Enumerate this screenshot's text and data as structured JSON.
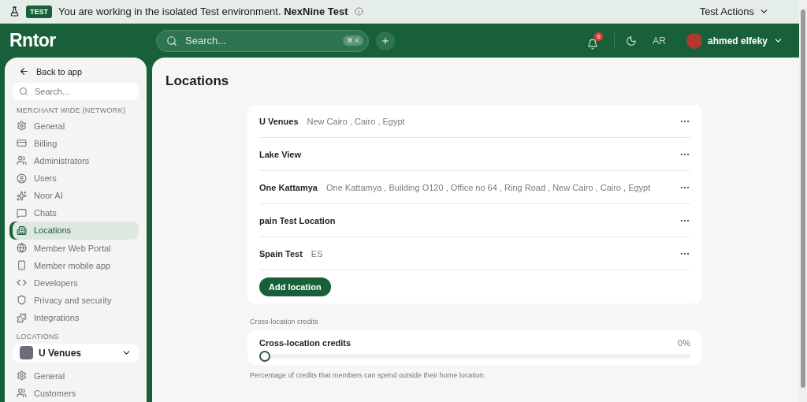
{
  "banner": {
    "badge": "TEST",
    "message": "You are working in the isolated Test environment. **NexNine Test**",
    "actions": "Test Actions"
  },
  "header": {
    "logo": "Rntor",
    "search_placeholder": "Search...",
    "shortcut": "⌘ K",
    "notifications": "6",
    "language": "AR",
    "user": "ahmed elfeky"
  },
  "sidebar": {
    "back": "Back to app",
    "search_placeholder": "Search...",
    "sections": [
      {
        "title": "MERCHANT WIDE (NETWORK)",
        "items": [
          {
            "label": "General",
            "kind": "gear",
            "selected": false
          },
          {
            "label": "Billing",
            "kind": "card",
            "selected": false
          },
          {
            "label": "Administrators",
            "kind": "users",
            "selected": false
          },
          {
            "label": "Users",
            "kind": "user",
            "selected": false
          },
          {
            "label": "Noor AI",
            "kind": "sparkles",
            "selected": false
          },
          {
            "label": "Chats",
            "kind": "chat",
            "selected": false
          },
          {
            "label": "Locations",
            "kind": "building",
            "selected": true
          },
          {
            "label": "Member Web Portal",
            "kind": "globe",
            "selected": false
          },
          {
            "label": "Member mobile app",
            "kind": "phone",
            "selected": false
          },
          {
            "label": "Developers",
            "kind": "code",
            "selected": false
          },
          {
            "label": "Privacy and security",
            "kind": "shield",
            "selected": false
          },
          {
            "label": "Integrations",
            "kind": "puzzle",
            "selected": false
          }
        ]
      },
      {
        "title": "LOCATIONS",
        "location": "U Venues",
        "items": [
          {
            "label": "General",
            "kind": "gear",
            "selected": false
          },
          {
            "label": "Customers",
            "kind": "users",
            "selected": false
          }
        ]
      }
    ]
  },
  "page": {
    "title": "Locations",
    "locations": [
      {
        "name": "U Venues",
        "address": "New Cairo , Cairo , Egypt"
      },
      {
        "name": "Lake View"
      },
      {
        "name": "One Kattamya",
        "address": "One Kattamya , Building O120 , Office no 64 , Ring Road , New Cairo , Cairo , Egypt"
      },
      {
        "name": "pain Test Location"
      },
      {
        "name": "Spain Test",
        "address": "ES"
      }
    ],
    "add_button": "Add location",
    "credits": {
      "section": "Cross-location credits",
      "label": "Cross-location credits",
      "reading": "0%",
      "level": 0,
      "help": "Percentage of credits that members can spend outside their home location."
    }
  }
}
